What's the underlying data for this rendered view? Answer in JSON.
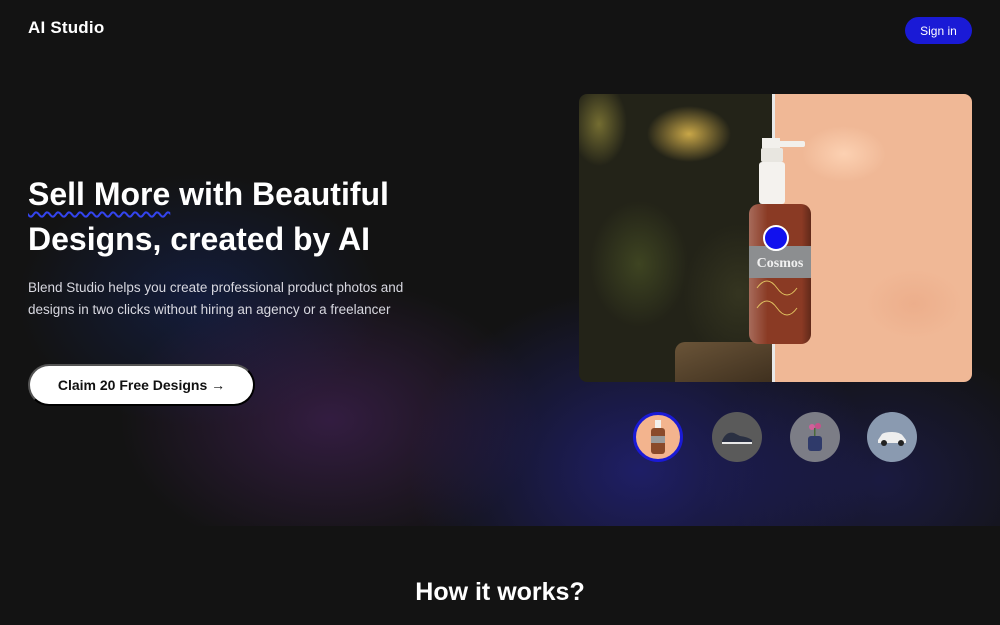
{
  "header": {
    "logo": "AI Studio",
    "signin_label": "Sign in"
  },
  "hero": {
    "headline_highlight": "Sell More",
    "headline_rest_line1": " with Beautiful",
    "headline_line2": "Designs, created by AI",
    "subtext": "Blend Studio helps you create professional product photos and designs in two clicks without hiring an agency or a freelancer",
    "cta_label": "Claim 20 Free Designs →"
  },
  "preview": {
    "product_label": "Cosmos",
    "thumbnails": [
      {
        "icon": "bottle-thumbnail",
        "active": true
      },
      {
        "icon": "shoe-thumbnail",
        "active": false
      },
      {
        "icon": "vase-thumbnail",
        "active": false
      },
      {
        "icon": "car-thumbnail",
        "active": false
      }
    ]
  },
  "how_it_works": {
    "title": "How it works?"
  },
  "colors": {
    "accent": "#1a1ad6",
    "background": "#131313"
  }
}
